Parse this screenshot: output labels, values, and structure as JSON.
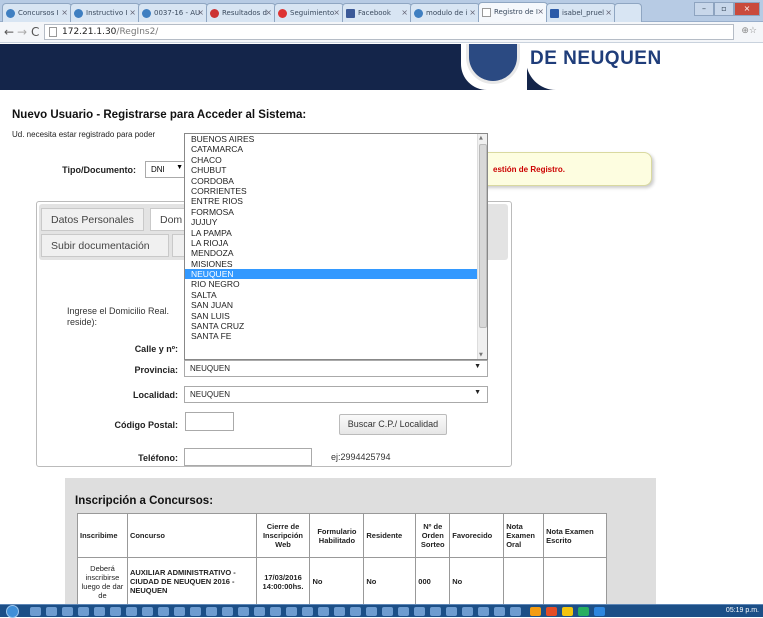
{
  "browser": {
    "tabs": [
      {
        "label": "Concursos I"
      },
      {
        "label": "Instructivo I"
      },
      {
        "label": "0037-16 - AU"
      },
      {
        "label": "Resultados d"
      },
      {
        "label": "Seguimiento"
      },
      {
        "label": "Facebook"
      },
      {
        "label": "modulo de i"
      },
      {
        "label": "Registro de I"
      },
      {
        "label": "isabel_pruel"
      }
    ],
    "url_host": "172.21.1.30",
    "url_path": "/RegIns2/"
  },
  "brand": {
    "text": "DE NEUQUEN"
  },
  "page": {
    "title": "Nuevo Usuario - Registrarse para Acceder al Sistema:",
    "intro": "Ud. necesita estar registrado para poder",
    "tipo_doc_label": "Tipo/Documento:",
    "tipo_doc_value": "DNI",
    "alert_text": "estión de Registro."
  },
  "tabs": {
    "datos_personales": "Datos Personales",
    "domicilio": "Dom",
    "subir_doc": "Subir documentación"
  },
  "form": {
    "domicilio_hint": "Ingrese el Domicilio Real. reside):",
    "calle_label": "Calle y nº:",
    "provincia_label": "Provincia:",
    "provincia_value": "NEUQUEN",
    "localidad_label": "Localidad:",
    "localidad_value": "NEUQUEN",
    "cp_label": "Código Postal:",
    "cp_button": "Buscar C.P./ Localidad",
    "telefono_label": "Teléfono:",
    "telefono_hint": "ej:2994425794"
  },
  "provincias": [
    "BUENOS AIRES",
    "CATAMARCA",
    "CHACO",
    "CHUBUT",
    "CORDOBA",
    "CORRIENTES",
    "ENTRE RIOS",
    "FORMOSA",
    "JUJUY",
    "LA PAMPA",
    "LA RIOJA",
    "MENDOZA",
    "MISIONES",
    "NEUQUEN",
    "RIO NEGRO",
    "SALTA",
    "SAN JUAN",
    "SAN LUIS",
    "SANTA CRUZ",
    "SANTA FE"
  ],
  "inscripcion": {
    "title": "Inscripción a Concursos:",
    "headers": {
      "inscribime": "Inscribime",
      "concurso": "Concurso",
      "cierre": "Cierre de Inscripción Web",
      "formulario": "Formulario Habilitado",
      "residente": "Residente",
      "orden": "Nº de Orden Sorteo",
      "favorecido": "Favorecido",
      "oral": "Nota Examen Oral",
      "escrito": "Nota Examen Escrito"
    },
    "row": {
      "inscribime": "Deberá inscribirse luego de dar de",
      "concurso": "AUXILIAR ADMINISTRATIVO - CIUDAD DE NEUQUEN 2016 - NEUQUEN",
      "cierre": "17/03/2016 14:00:00hs.",
      "formulario": "No",
      "residente": "No",
      "orden": "000",
      "favorecido": "No",
      "oral": "",
      "escrito": ""
    }
  },
  "taskbar": {
    "clock": "05:19 p.m."
  }
}
